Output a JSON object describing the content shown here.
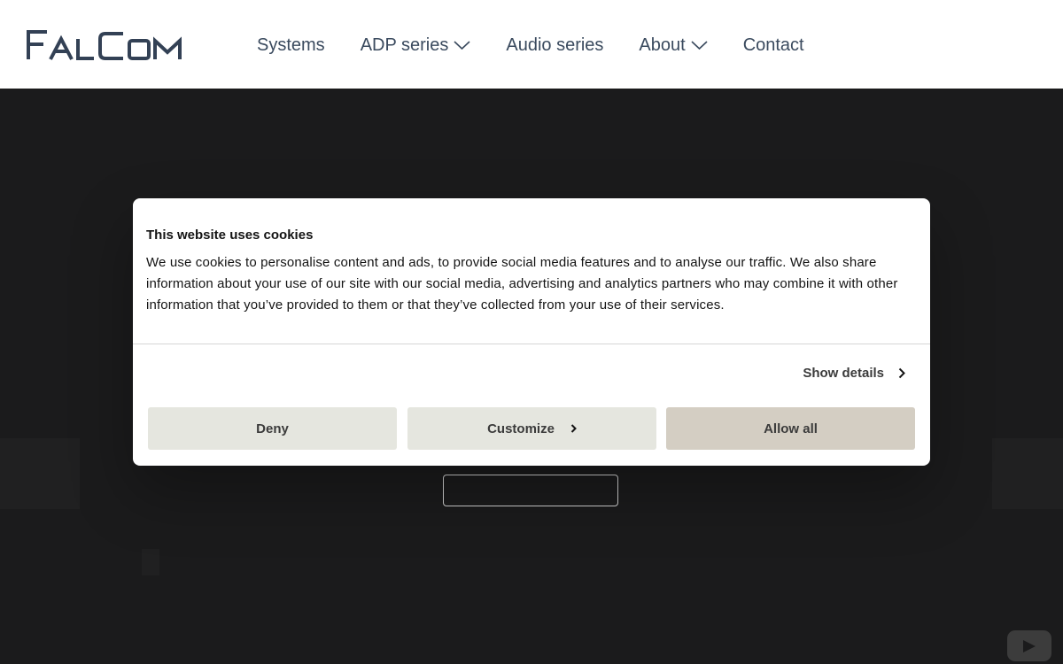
{
  "header": {
    "logo_text": "FALCOM",
    "nav": [
      {
        "label": "Systems",
        "has_dropdown": false
      },
      {
        "label": "ADP series",
        "has_dropdown": true
      },
      {
        "label": "Audio series",
        "has_dropdown": false
      },
      {
        "label": "About",
        "has_dropdown": true
      },
      {
        "label": "Contact",
        "has_dropdown": false
      }
    ]
  },
  "cookie_dialog": {
    "title": "This website uses cookies",
    "body": "We use cookies to personalise content and ads, to provide social media features and to analyse our traffic. We also share information about your use of our site with our social media, advertising and analytics partners who may combine it with other information that you’ve provided to them or that they’ve collected from your use of their services.",
    "show_details_label": "Show details",
    "buttons": {
      "deny": "Deny",
      "customize": "Customize",
      "allow_all": "Allow all"
    }
  },
  "colors": {
    "nav_text": "#3a4a5e",
    "hero_bg": "#1b1b1c",
    "allow_bg": "#d4cec3",
    "secondary_bg": "#e5e6df"
  },
  "icons": {
    "dropdown": "chevron-down-icon",
    "details_arrow": "chevron-right-icon",
    "video": "youtube-icon"
  }
}
